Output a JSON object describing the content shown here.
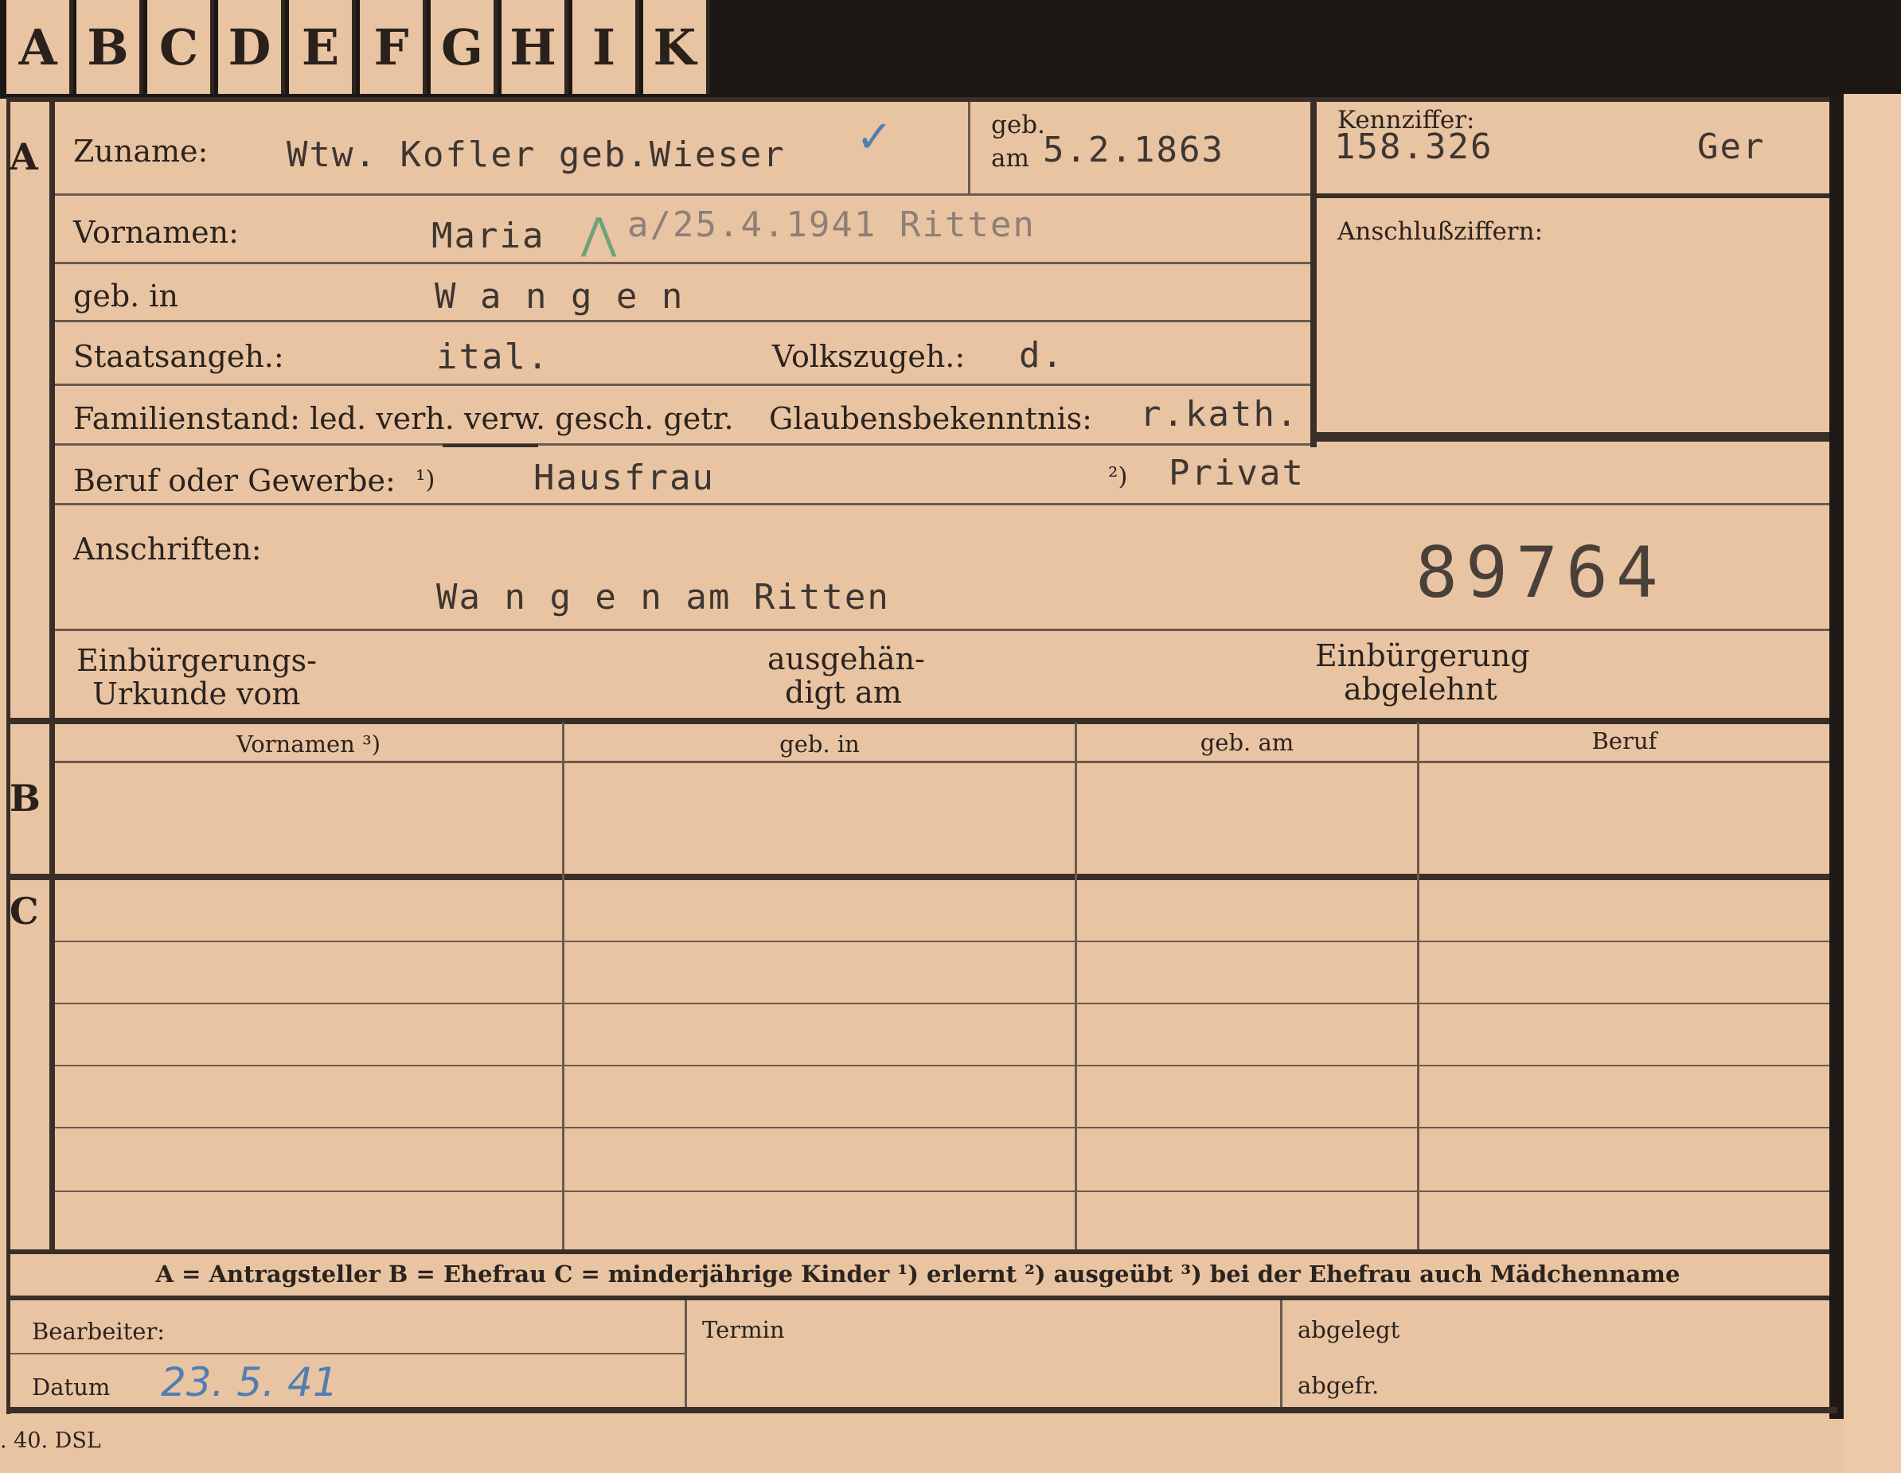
{
  "tabs": [
    "A",
    "B",
    "C",
    "D",
    "E",
    "F",
    "G",
    "H",
    "I",
    "K"
  ],
  "section_letters": {
    "a": "A",
    "b": "B",
    "c": "C"
  },
  "labels": {
    "zuname": "Zuname:",
    "geb_am_1": "geb.",
    "geb_am_2": "am",
    "kennziffer": "Kennziffer:",
    "vornamen": "Vornamen:",
    "anschlussziffern": "Anschlußziffern:",
    "geb_in": "geb. in",
    "staatsangeh": "Staatsangeh.:",
    "volkszugeh": "Volkszugeh.:",
    "familienstand": "Familienstand: led. verh. verw. gesch. getr.",
    "glaubensbekenntnis": "Glaubensbekenntnis:",
    "beruf": "Beruf oder Gewerbe:",
    "beruf_note1": "¹)",
    "beruf_note2": "²)",
    "anschriften": "Anschriften:",
    "einbuergerung_urkunde_1": "Einbürgerungs-",
    "einbuergerung_urkunde_2": "Urkunde vom",
    "ausgehaendigt_1": "ausgehän-",
    "ausgehaendigt_2": "digt am",
    "einbuergerung_abgelehnt_1": "Einbürgerung",
    "einbuergerung_abgelehnt_2": "abgelehnt"
  },
  "values": {
    "zuname": "Wtw. Kofler geb.Wieser",
    "geb_am": "5.2.1863",
    "kennziffer": "158.326",
    "kennziffer_suffix": "Ger",
    "vornamen": "Maria",
    "vornamen_note": "a/25.4.1941 Ritten",
    "geb_in": "W a n g e n",
    "staatsangeh": "ital.",
    "volkszugeh": "d.",
    "glaubensbekenntnis": "r.kath.",
    "beruf_1": "Hausfrau",
    "beruf_2": "Privat",
    "anschrift": "Wa n g e n  am Ritten",
    "stamp_number": "89764"
  },
  "table": {
    "headers": [
      "Vornamen ³)",
      "geb. in",
      "geb. am",
      "Beruf"
    ]
  },
  "legend": "A = Antragsteller   B = Ehefrau   C = minderjährige Kinder   ¹) erlernt   ²) ausgeübt   ³) bei der Ehefrau auch Mädchenname",
  "footer": {
    "bearbeiter": "Bearbeiter:",
    "datum": "Datum",
    "datum_value": "23. 5. 41",
    "termin": "Termin",
    "abgelegt": "abgelegt",
    "abgefr": "abgefr.",
    "print_mark": ". 40. DSL"
  }
}
